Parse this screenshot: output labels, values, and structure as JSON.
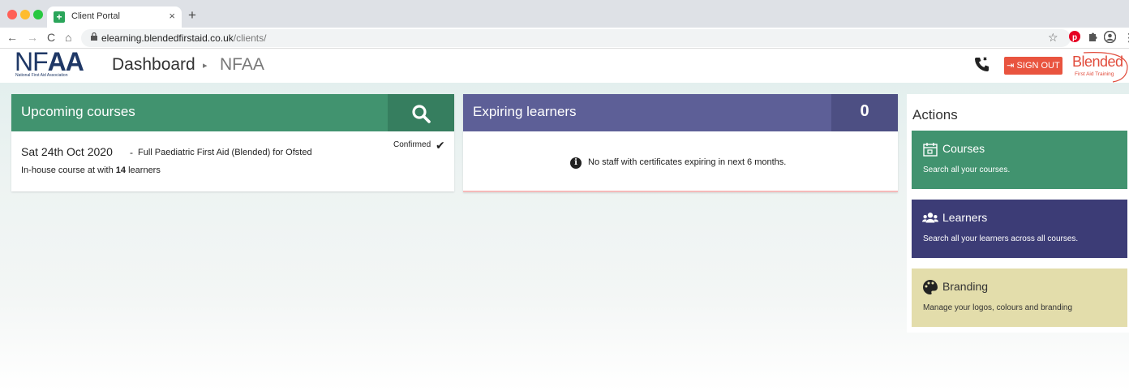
{
  "browser": {
    "tab_title": "Client Portal",
    "tab_close": "×",
    "new_tab": "+",
    "url_host": "elearning.blendedfirstaid.co.uk",
    "url_path": "/clients/",
    "back": "←",
    "forward": "→",
    "reload": "C",
    "home": "⌂",
    "lock": "🔒",
    "star": "☆",
    "menu": "⋮"
  },
  "header": {
    "logo_text_thin": "NF",
    "logo_text_bold": "AA",
    "logo_subtitle": "National First Aid Association",
    "title": "Dashboard",
    "breadcrumb_sep": "▸",
    "breadcrumb_current": "NFAA",
    "signout_label": "SIGN OUT",
    "signout_icon": "⇥",
    "partner_logo_word": "Blended",
    "partner_logo_sub": "First Aid Training"
  },
  "upcoming": {
    "title": "Upcoming courses",
    "search_icon": "search-icon",
    "course": {
      "date": "Sat 24th Oct 2020",
      "separator": "-",
      "name": "Full Paediatric First Aid (Blended) for Ofsted",
      "sub_prefix": "In-house course at with ",
      "learner_count": "14",
      "sub_suffix": " learners",
      "status": "Confirmed",
      "status_icon": "✔"
    }
  },
  "expiring": {
    "title": "Expiring learners",
    "count": "0",
    "empty_message": "No staff with certificates expiring in next 6 months.",
    "info_icon": "i"
  },
  "actions": {
    "title": "Actions",
    "items": [
      {
        "title": "Courses",
        "desc": "Search all your courses.",
        "icon": "calendar-icon"
      },
      {
        "title": "Learners",
        "desc": "Search all your learners across all courses.",
        "icon": "users-icon"
      },
      {
        "title": "Branding",
        "desc": "Manage your logos, colours and branding",
        "icon": "palette-icon"
      }
    ]
  },
  "colors": {
    "green": "#41936f",
    "purple_card": "#5d5f97",
    "purple_action": "#3c3c76",
    "branding": "#e3ddab",
    "signout": "#e9543f",
    "brand_navy": "#1f3866"
  }
}
